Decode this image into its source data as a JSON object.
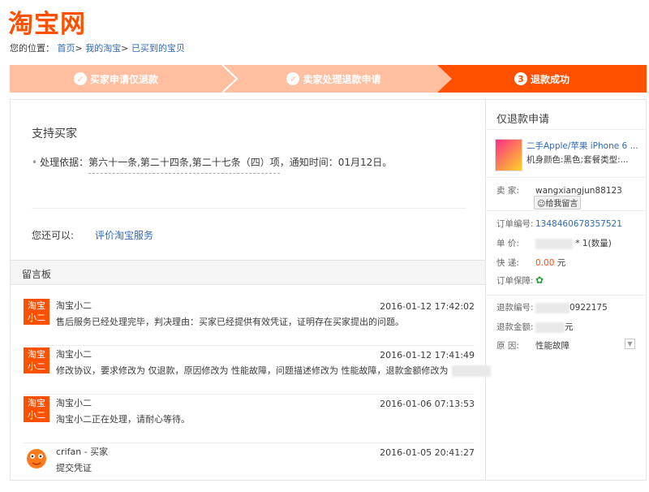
{
  "logo": "淘宝网",
  "breadcrumb": {
    "prefix": "您的位置：",
    "items": [
      "首页",
      "我的淘宝",
      "已买到的宝贝"
    ],
    "sep": ">"
  },
  "steps": [
    {
      "label": "买家申请仅退款",
      "done": true
    },
    {
      "label": "卖家处理退款申请",
      "done": true
    },
    {
      "label": "退款成功",
      "num": "3",
      "active": true
    }
  ],
  "main": {
    "title": "支持买家",
    "basis_label": "处理依据：",
    "basis_law": "第六十一条,第二十四条,第二十七条（四）项",
    "basis_time": "，通知时间：01月12日。",
    "also_label": "您还可以:",
    "also_link": "评价淘宝服务",
    "board_title": "留言板"
  },
  "messages": [
    {
      "avatar": "淘宝\n小二",
      "name": "淘宝小二",
      "time": "2016-01-12 17:42:02",
      "text": "售后服务已经处理完毕，判决理由：买家已经提供有效凭证，证明存在买家提出的问题。"
    },
    {
      "avatar": "淘宝\n小二",
      "name": "淘宝小二",
      "time": "2016-01-12 17:41:49",
      "text": "修改协议，要求修改为 仅退款，原因修改为 性能故障，问题描述修改为 性能故障，退款金额修改为"
    },
    {
      "avatar": "淘宝\n小二",
      "name": "淘宝小二",
      "time": "2016-01-06 07:13:53",
      "text": "淘宝小二正在处理，请耐心等待。"
    },
    {
      "avatar": "",
      "name": "crifan - 买家",
      "time": "2016-01-05 20:41:27",
      "text": "提交凭证"
    }
  ],
  "side": {
    "title": "仅退款申请",
    "product_title": "二手Apple/苹果 iPhone 6 ...",
    "product_attr": "机身颜色:黑色;套餐类型:...",
    "seller_label": "卖 家:",
    "seller": "wangxiangjun88123",
    "msg_button": "给我留言",
    "order_label": "订单编号:",
    "order_no": "1348460678357521",
    "price_label": "单 价:",
    "price_qty": "* 1(数量)",
    "ship_label": "快 递:",
    "ship_fee": "0.00",
    "ship_unit": "元",
    "protect_label": "订单保障:",
    "refund_no_label": "退款编号:",
    "refund_no_tail": "0922175",
    "refund_amt_label": "退款金额:",
    "refund_amt_unit": "元",
    "reason_label": "原 因:",
    "reason": "性能故障"
  },
  "colors": {
    "brand": "#ff5000",
    "step_done": "#ffbfa0",
    "link": "#2f6bb5"
  }
}
